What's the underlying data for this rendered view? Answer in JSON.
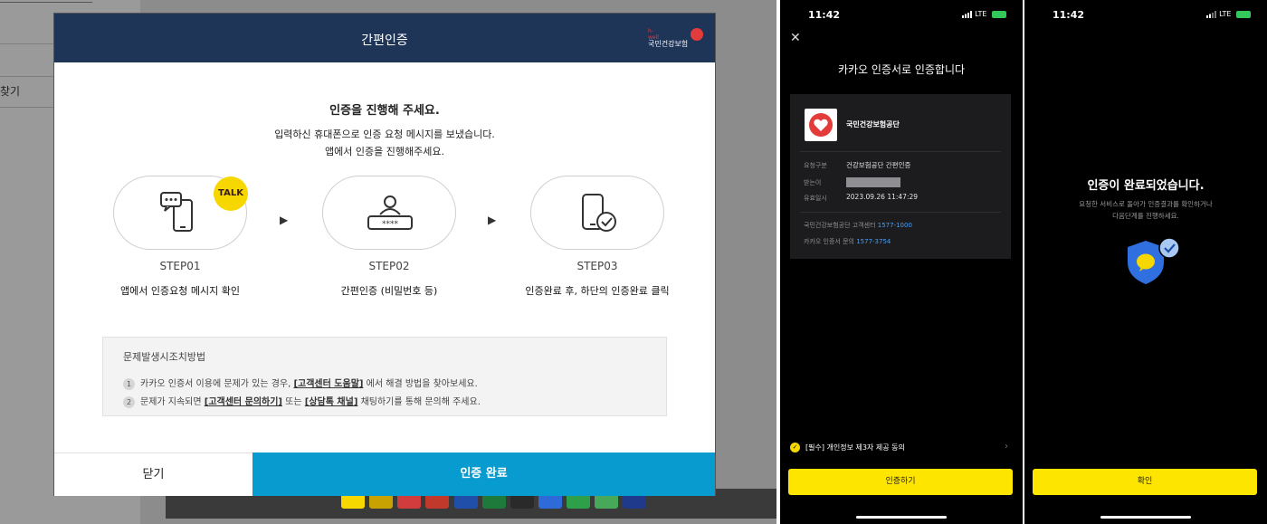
{
  "background": {
    "sidebar_label": "찾기"
  },
  "modal": {
    "title": "간편인증",
    "logo_small": "h-well",
    "logo_text": "국민건강보험",
    "lead": "인증을 진행해 주세요.",
    "description_line1": "입력하신 휴대폰으로 인증 요청 메시지를 보냈습니다.",
    "description_line2": "앱에서 인증을 진행해주세요.",
    "steps": [
      {
        "label": "STEP01",
        "description": "앱에서 인증요청 메시지 확인",
        "icon": "chat-phone-icon"
      },
      {
        "label": "STEP02",
        "description": "간편인증 (비밀번호 등)",
        "icon": "user-password-icon"
      },
      {
        "label": "STEP03",
        "description": "인증완료 후, 하단의 인증완료 클릭",
        "icon": "phone-check-icon"
      }
    ],
    "talk_badge": "TALK",
    "arrow": "▶",
    "trouble": {
      "title": "문제발생시조치방법",
      "items": [
        {
          "num": "1",
          "pre": "카카오 인증서 이용에 문제가 있는 경우, ",
          "link": "[고객센터 도움말]",
          "post": " 에서 해결 방법을 찾아보세요."
        },
        {
          "num": "2",
          "pre": "문제가 지속되면 ",
          "link": "[고객센터 문의하기]",
          "mid": " 또는 ",
          "link2": "[상담톡 채널]",
          "post": " 채팅하기를 통해 문의해 주세요."
        }
      ]
    },
    "close_label": "닫기",
    "confirm_label": "인증 완료"
  },
  "phone1": {
    "time": "11:42",
    "network": "LTE",
    "close_glyph": "✕",
    "title": "카카오 인증서로 인증합니다",
    "org_name": "국민건강보험공단",
    "fields": [
      {
        "key": "요청구분",
        "value": "건강보험공단 간편인증"
      },
      {
        "key": "받는이",
        "value": ""
      },
      {
        "key": "유효일시",
        "value": "2023.09.26 11:47:29"
      }
    ],
    "contact1_label": "국민건강보험공단 고객센터",
    "contact1_phone": "1577-1000",
    "contact2_label": "카카오 인증서 문의",
    "contact2_phone": "1577-3754",
    "agree_label": "[필수] 개인정보 제3자 제공 동의",
    "button_label": "인증하기"
  },
  "phone2": {
    "time": "11:42",
    "network": "LTE",
    "title": "인증이 완료되었습니다.",
    "desc_line1": "요청한 서비스로 돌아가 인증결과를 확인하거나",
    "desc_line2": "다음단계를 진행하세요.",
    "button_label": "확인"
  },
  "colors": {
    "modal_header": "#1f3558",
    "confirm_button": "#079bcf",
    "kakao_yellow": "#fee500",
    "shield_blue": "#2f6fe0"
  }
}
